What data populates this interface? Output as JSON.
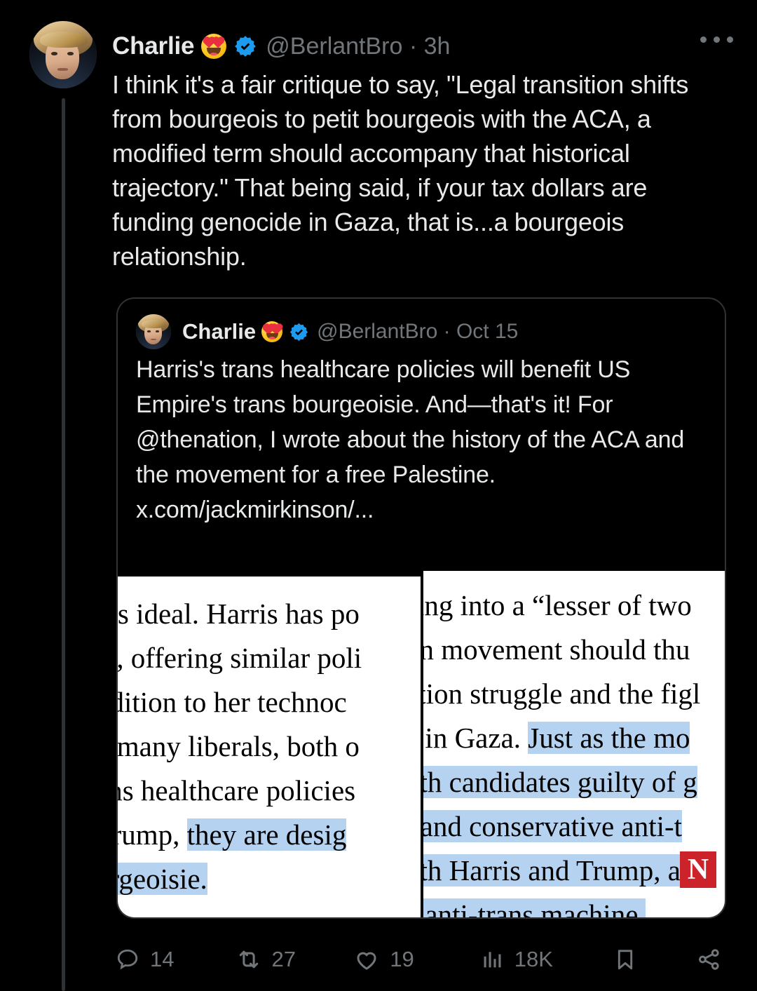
{
  "post": {
    "author": {
      "display_name": "Charlie",
      "name_emoji": "heart-eyes-emoji",
      "verified": true,
      "handle": "@BerlantBro",
      "separator": "·",
      "timestamp": "3h"
    },
    "handle_time": "@BerlantBro · 3h",
    "body": "I think it's a fair critique to say, \"Legal transition shifts from bourgeois to petit bourgeois with the ACA, a modified term should accompany that historical trajectory.\" That being said, if your tax dollars are funding genocide in Gaza, that is...a bourgeois relationship.",
    "more_menu_label": "More"
  },
  "quoted_post": {
    "author": {
      "display_name": "Charlie",
      "name_emoji": "heart-eyes-emoji",
      "verified": true,
      "handle": "@BerlantBro",
      "separator": "·",
      "timestamp": "Oct 15"
    },
    "handle_time": "@BerlantBro · Oct 15",
    "body": "Harris's trans healthcare policies will benefit US Empire's trans bourgeoisie. And—that's it! For @thenation, I wrote about the history of the ACA and the movement for a free Palestine. x.com/jackmirkinson/...",
    "media": {
      "left_screenshot": {
        "lines": [
          ", is ideal. Harris has po",
          "er, offering similar poli",
          "ddition to her technoc",
          "y many liberals, both o",
          "ans healthcare policies",
          "Trump, |they are desig",
          "urgeoisie."
        ],
        "line_1": ", is ideal. Harris has po",
        "line_2": "er, offering similar poli",
        "line_3": "ddition to her technoc",
        "line_4": "y many liberals, both o",
        "line_5": "ans healthcare policies",
        "line_6_plain": "Trump, ",
        "line_6_highlight": "they are desig",
        "line_7_highlight": "urgeoisie."
      },
      "right_screenshot": {
        "line_1": "sing into a “lesser of two",
        "line_2": "on movement should thu",
        "line_3": "ation struggle and the figl",
        "line_4_plain": "e in Gaza. ",
        "line_4_highlight": "Just as the mo",
        "line_5_highlight": "oth candidates guilty of g",
        "line_6_highlight": "l and conservative anti-t",
        "line_7_highlight": "oth Harris and Trump, as",
        "line_8_highlight": "e anti-trans machine.",
        "publisher_logo": "N"
      },
      "highlight_color": "#b5d3f0"
    }
  },
  "actions": {
    "reply": {
      "icon": "reply-icon",
      "count": "14"
    },
    "repost": {
      "icon": "repost-icon",
      "count": "27"
    },
    "like": {
      "icon": "heart-icon",
      "count": "19"
    },
    "views": {
      "icon": "analytics-icon",
      "count": "18K"
    },
    "bookmark": {
      "icon": "bookmark-icon",
      "count": ""
    },
    "share": {
      "icon": "share-icon",
      "count": ""
    }
  },
  "colors": {
    "background": "#000000",
    "text_primary": "#e7e9ea",
    "text_secondary": "#71767b",
    "verified_blue": "#1d9bf0",
    "border": "#2f3336",
    "highlight": "#b5d3f0",
    "logo_red": "#cc2229"
  }
}
